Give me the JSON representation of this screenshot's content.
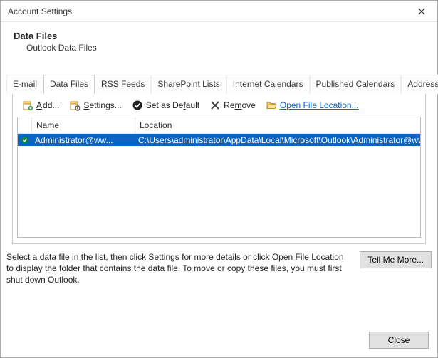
{
  "window": {
    "title": "Account Settings"
  },
  "header": {
    "title": "Data Files",
    "subtitle": "Outlook Data Files"
  },
  "tabs": {
    "email": "E-mail",
    "data_files": "Data Files",
    "rss": "RSS Feeds",
    "sharepoint": "SharePoint Lists",
    "ical": "Internet Calendars",
    "pubcal": "Published Calendars",
    "addr": "Address Books",
    "active": "data_files"
  },
  "toolbar": {
    "add": "Add...",
    "settings": "Settings...",
    "set_default": "Set as Default",
    "remove": "Remove",
    "open_loc": "Open File Location..."
  },
  "list": {
    "columns": {
      "name": "Name",
      "location": "Location"
    },
    "rows": [
      {
        "default": true,
        "name": "Administrator@ww...",
        "location": "C:\\Users\\administrator\\AppData\\Local\\Microsoft\\Outlook\\Administrator@ww...",
        "selected": true
      }
    ]
  },
  "help": {
    "text": "Select a data file in the list, then click Settings for more details or click Open File Location to display the folder that contains the data file. To move or copy these files, you must first shut down Outlook.",
    "button": "Tell Me More..."
  },
  "footer": {
    "close": "Close"
  }
}
